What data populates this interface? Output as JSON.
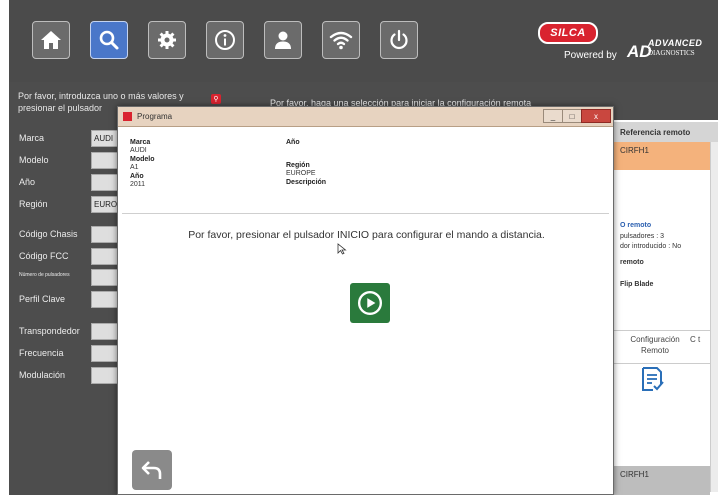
{
  "toolbar": {
    "buttons": [
      {
        "name": "home",
        "icon": "home-icon"
      },
      {
        "name": "search",
        "icon": "search-icon",
        "active": true
      },
      {
        "name": "settings",
        "icon": "gear-icon"
      },
      {
        "name": "info",
        "icon": "info-icon"
      },
      {
        "name": "user",
        "icon": "user-icon"
      },
      {
        "name": "wifi",
        "icon": "wifi-icon"
      },
      {
        "name": "power",
        "icon": "power-icon"
      }
    ],
    "brand": {
      "silca": "SILCA",
      "powered_by": "Powered by",
      "ad_mark": "AD",
      "advanced": "ADVANCED",
      "diagnostics": "DIAGNOSTICS"
    }
  },
  "left_panel": {
    "instruction": "Por favor, introduzca uno o más valores y presionar el pulsador",
    "selection_instruction": "Por favor, haga una selección para iniciar la configuración remota",
    "fields": [
      {
        "label": "Marca",
        "value": "AUDI"
      },
      {
        "label": "Modelo",
        "value": ""
      },
      {
        "label": "Año",
        "value": ""
      },
      {
        "label": "Región",
        "value": "EURO"
      },
      {
        "label": "Código Chasis",
        "value": ""
      },
      {
        "label": "Código FCC",
        "value": ""
      },
      {
        "label": "Número de pulsadores",
        "value": ""
      },
      {
        "label": "Perfil Clave",
        "value": ""
      },
      {
        "label": "Transpondedor",
        "value": ""
      },
      {
        "label": "Frecuencia",
        "value": ""
      },
      {
        "label": "Modulación",
        "value": ""
      }
    ]
  },
  "right_panel": {
    "header": "Referencia remoto",
    "selected": "CIRFH1",
    "detail_title": "O remoto",
    "detail_buttons": "pulsadores : 3",
    "detail_code": "dor introducido : No",
    "detail_remote": "remoto",
    "detail_blade": "Flip Blade",
    "column_header": "Configuración Remoto",
    "column_header2": "C t",
    "footer": "CIRFH1"
  },
  "dialog": {
    "title": "Programa",
    "window_buttons": [
      "_",
      "□",
      "x"
    ],
    "info": {
      "brand_label": "Marca",
      "brand_value": "AUDI",
      "model_label": "Modelo",
      "model_value": "A1",
      "year_label": "Año",
      "year_value": "2011",
      "year_label2": "Año",
      "region_label": "Región",
      "region_value": "EUROPE",
      "description_label": "Descripción"
    },
    "message": "Por favor, presionar el pulsador INICIO para configurar el mando a distancia."
  },
  "colors": {
    "topbar": "#4b4b4b",
    "active_button": "#4a77c9",
    "brand_red": "#d9232f",
    "selection_orange": "#f4b27c",
    "play_green": "#2a7a3c",
    "dialog_title": "#e7d3c0"
  }
}
